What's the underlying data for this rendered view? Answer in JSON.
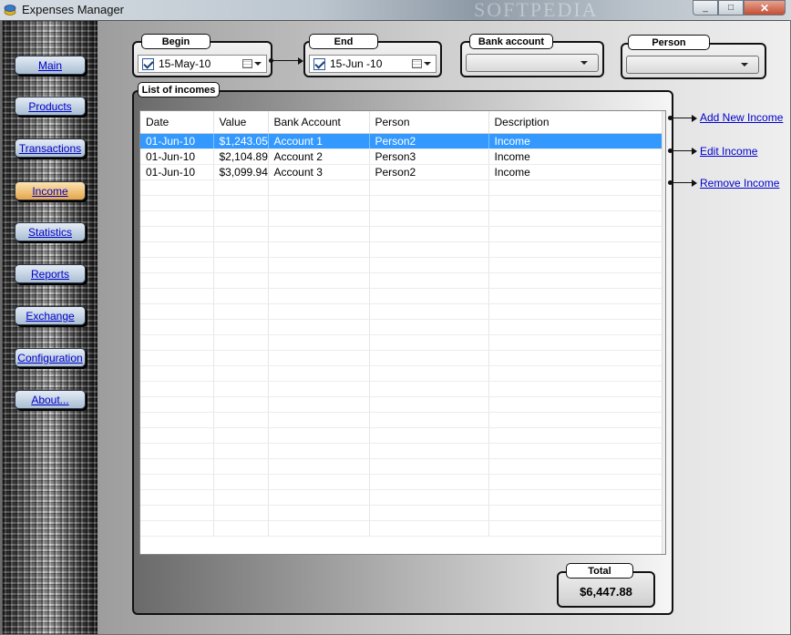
{
  "window": {
    "title": "Expenses Manager",
    "watermark": "SOFTPEDIA",
    "min": "_",
    "max": "□",
    "close": "✕"
  },
  "nav": [
    {
      "label": "Main",
      "active": false
    },
    {
      "label": "Products",
      "active": false
    },
    {
      "label": "Transactions",
      "active": false
    },
    {
      "label": "Income",
      "active": true
    },
    {
      "label": "Statistics",
      "active": false
    },
    {
      "label": "Reports",
      "active": false
    },
    {
      "label": "Exchange",
      "active": false
    },
    {
      "label": "Configuration",
      "active": false
    },
    {
      "label": "About...",
      "active": false
    }
  ],
  "filters": {
    "begin": {
      "label": "Begin",
      "checked": true,
      "value": "15-May-10"
    },
    "end": {
      "label": "End",
      "checked": true,
      "value": "15-Jun -10"
    },
    "bank_account": {
      "label": "Bank account",
      "value": ""
    },
    "person": {
      "label": "Person",
      "value": ""
    }
  },
  "list": {
    "title": "List of incomes",
    "columns": [
      "Date",
      "Value",
      "Bank Account",
      "Person",
      "Description"
    ],
    "rows": [
      {
        "date": "01-Jun-10",
        "value": "$1,243.05",
        "account": "Account 1",
        "person": "Person2",
        "description": "Income",
        "selected": true
      },
      {
        "date": "01-Jun-10",
        "value": "$2,104.89",
        "account": "Account 2",
        "person": "Person3",
        "description": "Income",
        "selected": false
      },
      {
        "date": "01-Jun-10",
        "value": "$3,099.94",
        "account": "Account 3",
        "person": "Person2",
        "description": "Income",
        "selected": false
      }
    ]
  },
  "actions": {
    "add": "Add New Income",
    "edit": "Edit Income",
    "remove": "Remove Income"
  },
  "total": {
    "label": "Total",
    "value": "$6,447.88"
  },
  "colors": {
    "selection": "#3399ff",
    "link": "#0000cc",
    "active_nav": "#e5a64a"
  }
}
